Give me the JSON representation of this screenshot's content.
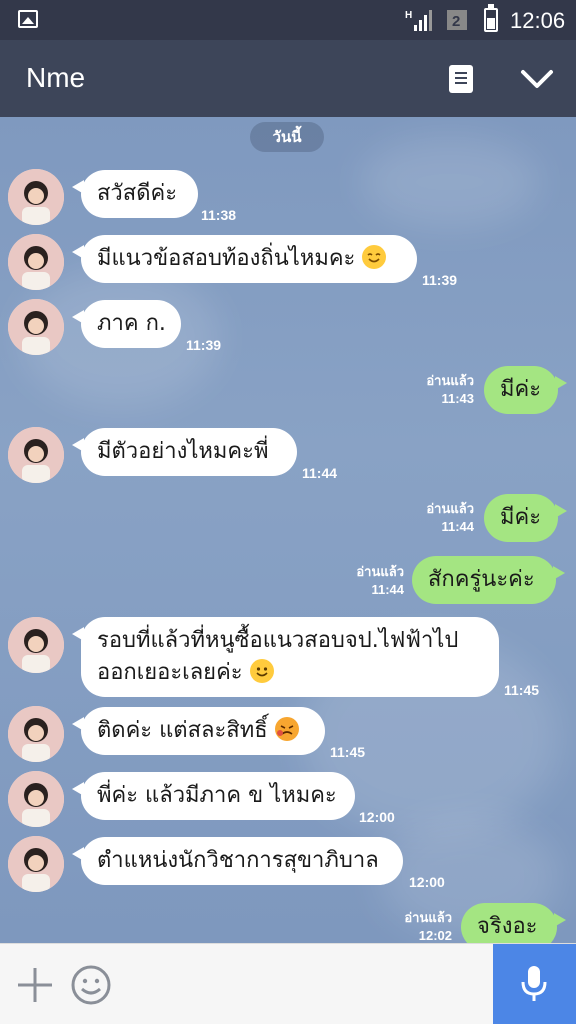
{
  "status_bar": {
    "time": "12:06",
    "signal_label": "H",
    "sim_label": "2"
  },
  "header": {
    "title": "Nme"
  },
  "chat": {
    "date_label": "วันนี้",
    "messages": [
      {
        "side": "in",
        "text": "สวัสดีค่ะ",
        "time": "11:38"
      },
      {
        "side": "in",
        "text": "มีแนวข้อสอบท้องถิ่นไหมคะ",
        "emoji": "smiling-face",
        "time": "11:39"
      },
      {
        "side": "in",
        "text": "ภาค ก.",
        "time": "11:39"
      },
      {
        "side": "out",
        "text": "มีค่ะ",
        "read": "อ่านแล้ว",
        "time": "11:43"
      },
      {
        "side": "in",
        "text": "มีตัวอย่างไหมคะพี่",
        "time": "11:44"
      },
      {
        "side": "out",
        "text": "มีค่ะ",
        "read": "อ่านแล้ว",
        "time": "11:44"
      },
      {
        "side": "out",
        "text": "สักครู่นะค่ะ",
        "read": "อ่านแล้ว",
        "time": "11:44"
      },
      {
        "side": "in",
        "text_line1": "รอบที่แล้วที่หนูซื้อแนวสอบจป.ไฟฟ้าไป",
        "text_line2": "ออกเยอะเลยค่ะ",
        "emoji": "smiling-face",
        "time": "11:45"
      },
      {
        "side": "in",
        "text": "ติดค่ะ แต่สละสิทธิ์",
        "emoji": "sad-face",
        "time": "11:45"
      },
      {
        "side": "in",
        "text": "พี่ค่ะ แล้วมีภาค ข ไหมคะ",
        "time": "12:00"
      },
      {
        "side": "in",
        "text": "ตำแหน่งนักวิชาการสุขาภิบาล",
        "time": "12:00"
      },
      {
        "side": "out",
        "text": "จริงอะ",
        "read": "อ่านแล้ว",
        "time": "12:02"
      }
    ]
  },
  "colors": {
    "header": "#3d4559",
    "incoming": "#ffffff",
    "outgoing": "#a4e582",
    "mic": "#4c86e6"
  }
}
